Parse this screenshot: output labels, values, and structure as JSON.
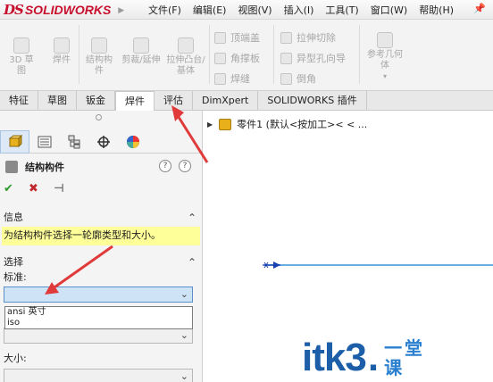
{
  "app": {
    "ds_mark": "DS",
    "brand": "SOLIDWORKS",
    "brand_color": "#c8102e"
  },
  "menu": [
    "文件(F)",
    "编辑(E)",
    "视图(V)",
    "插入(I)",
    "工具(T)",
    "窗口(W)",
    "帮助(H)"
  ],
  "ribbon": {
    "sketch": "3D 草图",
    "weldment": "焊件",
    "structural_member": "结构构件",
    "trim_extend": "剪裁/延伸",
    "extruded_boss": "拉伸凸台/基体",
    "end_cap": "顶端盖",
    "gusset": "角撑板",
    "weld_bead": "焊缝",
    "extruded_cut": "拉伸切除",
    "hole_wizard": "异型孔向导",
    "chamfer": "倒角",
    "ref_geometry": "参考几何体"
  },
  "tabs": [
    "特征",
    "草图",
    "钣金",
    "焊件",
    "评估",
    "DimXpert",
    "SOLIDWORKS 插件"
  ],
  "active_tab": "焊件",
  "panel": {
    "title": "结构构件",
    "info_header": "信息",
    "info_text": "为结构构件选择一轮廓类型和大小。",
    "selection_header": "选择",
    "standard_label": "标准:",
    "standard_value": "",
    "options": [
      "ansi 英寸",
      "iso"
    ],
    "size_label": "大小:"
  },
  "tree": {
    "label": "零件1 (默认<按加工>< < ..."
  },
  "watermark": {
    "main": "itk3",
    "dot": ".",
    "cn_top": "一堂",
    "cn_bottom": "课"
  },
  "colors": {
    "info_bg": "#ffff99",
    "select_highlight": "#cfe3f7",
    "arrow": "#e03a3a"
  }
}
